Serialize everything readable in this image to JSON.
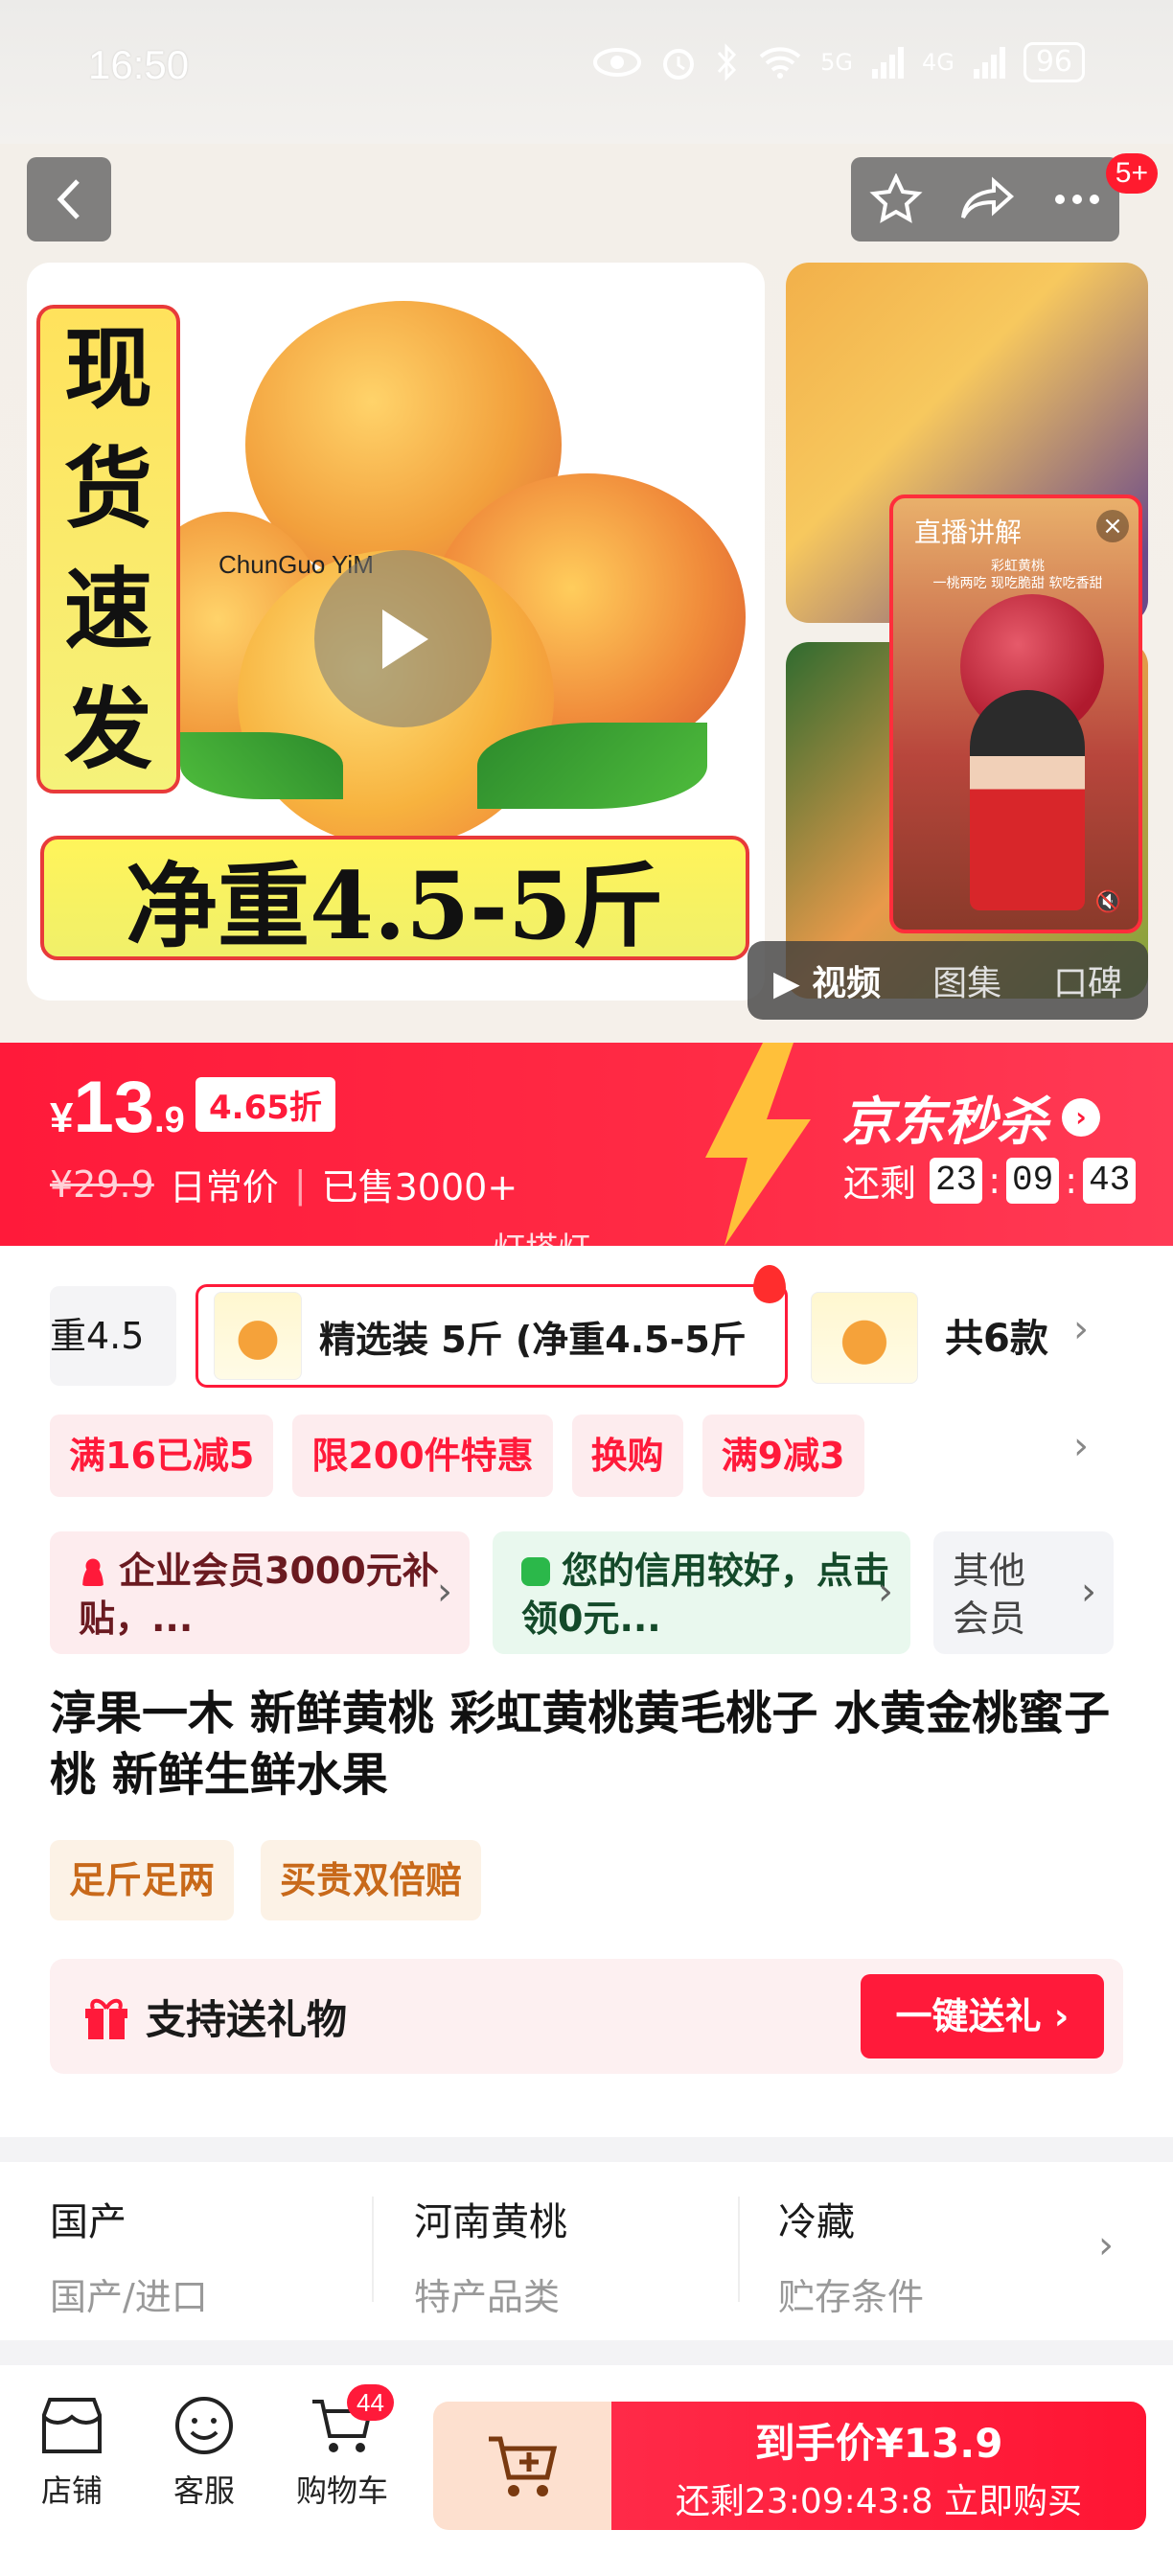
{
  "status_bar": {
    "time": "16:50",
    "icons": [
      "eye-icon",
      "alarm-icon",
      "bluetooth-icon",
      "wifi-icon",
      "5g-signal-icon",
      "4g-signal-icon"
    ],
    "signal_5g": "5G",
    "signal_4g": "4G",
    "battery": "96"
  },
  "header": {
    "notification_badge": "5+"
  },
  "gallery": {
    "banner_vertical": [
      "现",
      "货",
      "速",
      "发"
    ],
    "banner_horizontal": "净重4.5-5斤",
    "brand_logo": "ChunGuo YiM",
    "live_popup": {
      "title": "直播讲解",
      "subtitle_1": "彩虹黄桃",
      "subtitle_2": "一桃两吃 现吃脆甜 软吃香甜"
    },
    "media_tabs": [
      "视频",
      "图集",
      "口碑"
    ],
    "active_tab": "视频"
  },
  "price": {
    "currency": "¥",
    "integer": "13",
    "decimal": ".9",
    "discount": "4.65折",
    "original": "¥29.9",
    "original_label": "日常价",
    "sold": "已售3000+",
    "seckill_title": "京东秒杀",
    "countdown_label": "还剩",
    "countdown": [
      "23",
      "09",
      "43"
    ],
    "watermark": "灯塔灯"
  },
  "sku": {
    "prev_fragment": "重4.5",
    "selected": "精选装 5斤 (净重4.5-5斤",
    "count": "共6款"
  },
  "promos": [
    "满16已减5",
    "限200件特惠",
    "换购",
    "满9减3"
  ],
  "members": {
    "enterprise": "企业会员3000元补贴，...",
    "credit": "您的信用较好，点击领0元...",
    "other": "其他会员"
  },
  "product": {
    "title": "淳果一木 新鲜黄桃 彩虹黄桃黄毛桃子 水黄金桃蜜子桃 新鲜生鲜水果",
    "guarantees": [
      "足斤足两",
      "买贵双倍赔"
    ]
  },
  "gift": {
    "label": "支持送礼物",
    "button": "一键送礼"
  },
  "attributes": [
    {
      "value": "国产",
      "key": "国产/进口"
    },
    {
      "value": "河南黄桃",
      "key": "特产品类"
    },
    {
      "value": "冷藏",
      "key": "贮存条件"
    }
  ],
  "bottom_bar": {
    "store": "店铺",
    "service": "客服",
    "cart": "购物车",
    "cart_count": "44",
    "buy_price_label": "到手价",
    "buy_price": "¥13.9",
    "buy_countdown": "还剩23:09:43:8",
    "buy_action": "立即购买"
  },
  "colors": {
    "accent": "#ff1a3a",
    "promo_bg": "#fdecee",
    "guarantee_text": "#c8691a",
    "credit_bg": "#e9f8ee"
  }
}
